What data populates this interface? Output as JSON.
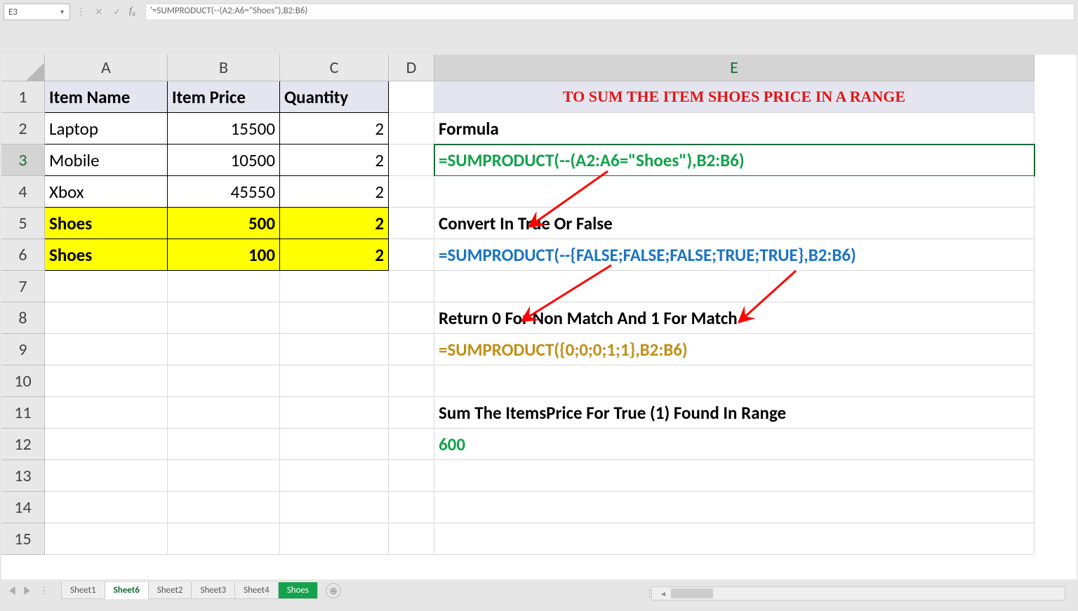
{
  "nameBox": "E3",
  "formulaBar": "'=SUMPRODUCT(--(A2:A6=\"Shoes\"),B2:B6)",
  "columns": [
    "A",
    "B",
    "C",
    "D",
    "E"
  ],
  "rowNums": [
    "1",
    "2",
    "3",
    "4",
    "5",
    "6",
    "7",
    "8",
    "9",
    "10",
    "11",
    "12",
    "13",
    "14",
    "15"
  ],
  "headers": {
    "A": "Item Name",
    "B": "Item Price",
    "C": "Quantity"
  },
  "data": [
    {
      "A": "Laptop",
      "B": "15500",
      "C": "2"
    },
    {
      "A": "Mobile",
      "B": "10500",
      "C": "2"
    },
    {
      "A": "Xbox",
      "B": "45550",
      "C": "2"
    },
    {
      "A": "Shoes",
      "B": "500",
      "C": "2"
    },
    {
      "A": "Shoes",
      "B": "100",
      "C": "2"
    }
  ],
  "E": {
    "title": "TO SUM THE ITEM SHOES PRICE IN A RANGE",
    "l2": "Formula",
    "l3": "=SUMPRODUCT(--(A2:A6=\"Shoes\"),B2:B6)",
    "l5": "Convert In True Or False",
    "l6": "=SUMPRODUCT(--{FALSE;FALSE;FALSE;TRUE;TRUE},B2:B6)",
    "l8": "Return 0 For Non Match And 1 For Match",
    "l9": "=SUMPRODUCT({0;0;0;1;1},B2:B6)",
    "l11": "Sum The ItemsPrice For True (1) Found In Range",
    "l12": "600"
  },
  "tabs": [
    "Sheet1",
    "Sheet6",
    "Sheet2",
    "Sheet3",
    "Sheet4",
    "Shoes"
  ],
  "chart_data": {
    "type": "table",
    "columns": [
      "Item Name",
      "Item Price",
      "Quantity"
    ],
    "rows": [
      [
        "Laptop",
        15500,
        2
      ],
      [
        "Mobile",
        10500,
        2
      ],
      [
        "Xbox",
        45550,
        2
      ],
      [
        "Shoes",
        500,
        2
      ],
      [
        "Shoes",
        100,
        2
      ]
    ],
    "explanation": {
      "formula": "=SUMPRODUCT(--(A2:A6=\"Shoes\"),B2:B6)",
      "step_boolean": "=SUMPRODUCT(--{FALSE;FALSE;FALSE;TRUE;TRUE},B2:B6)",
      "step_binary": "=SUMPRODUCT({0;0;0;1;1},B2:B6)",
      "result": 600
    }
  }
}
